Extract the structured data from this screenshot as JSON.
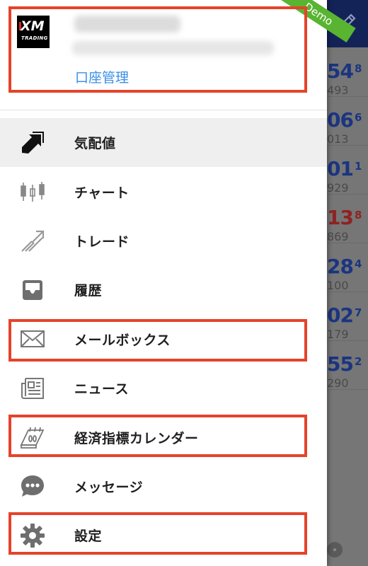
{
  "background": {
    "quotes": [
      {
        "big": "54",
        "sup": "8",
        "small": "493",
        "color": "blue"
      },
      {
        "big": "06",
        "sup": "6",
        "small": "013",
        "color": "blue"
      },
      {
        "big": "01",
        "sup": "1",
        "small": "929",
        "color": "blue"
      },
      {
        "big": "13",
        "sup": "8",
        "small": "869",
        "color": "red"
      },
      {
        "big": "28",
        "sup": "4",
        "small": "100",
        "color": "blue"
      },
      {
        "big": "02",
        "sup": "7",
        "small": "179",
        "color": "blue"
      },
      {
        "big": "55",
        "sup": "2",
        "small": "290",
        "color": "blue"
      }
    ],
    "ribbon_label": "Demo"
  },
  "account": {
    "logo_text": "XM",
    "logo_sub": "TRADING",
    "manage_link": "口座管理"
  },
  "menu": {
    "items": [
      {
        "label": "気配値",
        "icon": "quotes-icon"
      },
      {
        "label": "チャート",
        "icon": "chart-icon"
      },
      {
        "label": "トレード",
        "icon": "trade-icon"
      },
      {
        "label": "履歴",
        "icon": "history-icon"
      },
      {
        "label": "メールボックス",
        "icon": "mailbox-icon"
      },
      {
        "label": "ニュース",
        "icon": "news-icon"
      },
      {
        "label": "経済指標カレンダー",
        "icon": "calendar-icon"
      },
      {
        "label": "メッセージ",
        "icon": "message-icon"
      },
      {
        "label": "設定",
        "icon": "gear-icon"
      }
    ]
  },
  "colors": {
    "highlight": "#e5432a",
    "link": "#3a8fe6",
    "header_navy": "#142357",
    "ribbon_green": "#59b431"
  }
}
